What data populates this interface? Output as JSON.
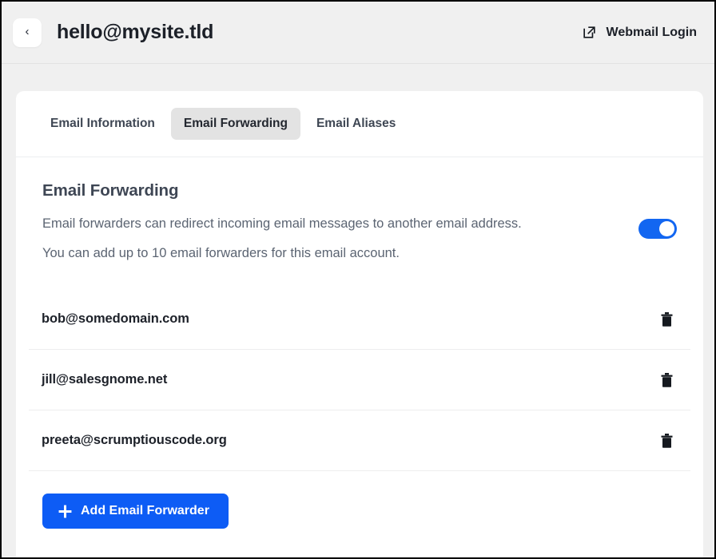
{
  "header": {
    "back_label": "‹",
    "back_icon": "chevron-left-icon",
    "account_email": "hello@mysite.tld",
    "webmail_label": "Webmail Login",
    "webmail_icon": "external-link-icon"
  },
  "tabs": [
    {
      "label": "Email Information",
      "active": false
    },
    {
      "label": "Email Forwarding",
      "active": true
    },
    {
      "label": "Email Aliases",
      "active": false
    }
  ],
  "section": {
    "title": "Email Forwarding",
    "description_line_1": "Email forwarders can redirect incoming email messages to another email address.",
    "description_line_2": "You can add up to 10 email forwarders for this email account.",
    "toggle": {
      "state": "on",
      "accent_color": "#1266f1",
      "knob_color": "#ffffff"
    }
  },
  "forwarders": [
    {
      "email": "bob@somedomain.com",
      "delete_icon": "trash-icon"
    },
    {
      "email": "jill@salesgnome.net",
      "delete_icon": "trash-icon"
    },
    {
      "email": "preeta@scrumptiouscode.org",
      "delete_icon": "trash-icon"
    }
  ],
  "add_button": {
    "label": "Add Email Forwarder",
    "icon": "plus-icon",
    "color": "#0d5cf5"
  },
  "colors": {
    "page_background": "#f0f0f0",
    "card_background": "#ffffff",
    "active_tab_background": "#e3e3e3",
    "text_primary": "#1d2129",
    "text_muted": "#5b6472",
    "divider": "#ededee"
  }
}
